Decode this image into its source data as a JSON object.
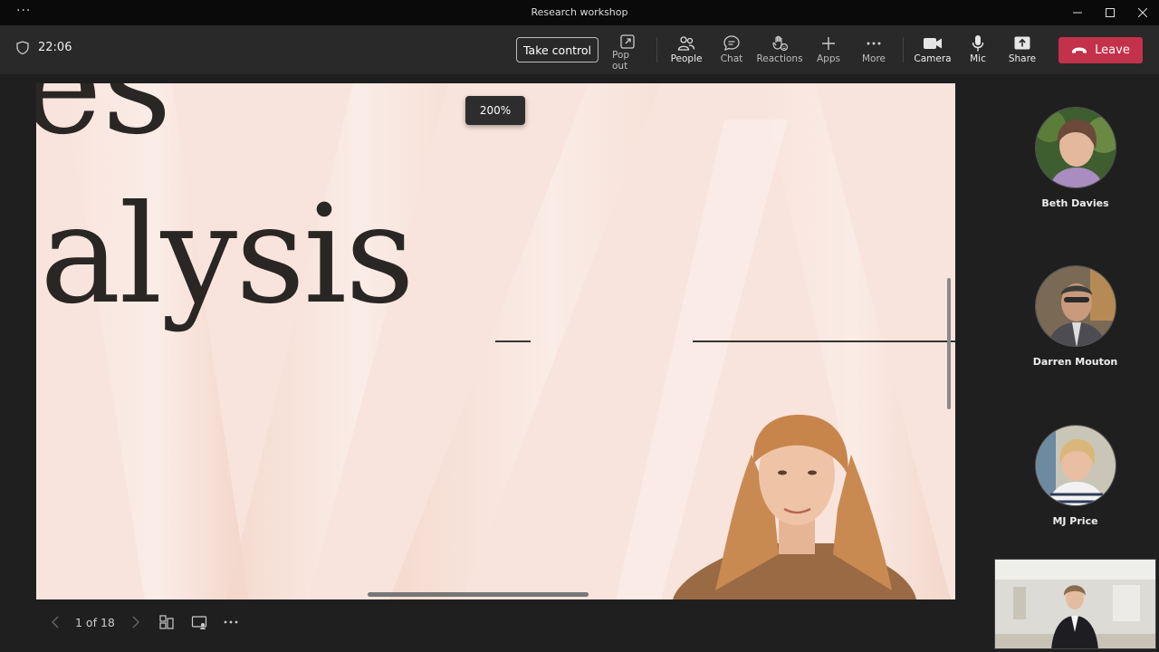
{
  "window": {
    "title": "Research workshop",
    "menu_icon": "more-horizontal-icon",
    "controls": [
      "minimize-icon",
      "maximize-icon",
      "close-icon"
    ]
  },
  "toolbar": {
    "timer": "22:06",
    "take_control_label": "Take control",
    "items": [
      {
        "label": "Pop out",
        "icon": "pop-out-icon"
      },
      {
        "label": "People",
        "icon": "people-icon"
      },
      {
        "label": "Chat",
        "icon": "chat-icon"
      },
      {
        "label": "Reactions",
        "icon": "reactions-icon"
      },
      {
        "label": "Apps",
        "icon": "plus-icon"
      },
      {
        "label": "More",
        "icon": "more-icon"
      },
      {
        "label": "Camera",
        "icon": "camera-icon"
      },
      {
        "label": "Mic",
        "icon": "mic-icon"
      },
      {
        "label": "Share",
        "icon": "share-icon"
      }
    ],
    "leave_label": "Leave"
  },
  "presentation": {
    "zoom_level": "200%",
    "slide_text_top": "es",
    "slide_text_main": "alysis",
    "page_indicator": "1 of 18"
  },
  "participants": [
    {
      "name": "Beth Davies"
    },
    {
      "name": "Darren Mouton"
    },
    {
      "name": "MJ Price"
    }
  ],
  "colors": {
    "leave": "#c4314b",
    "toolbar": "#292929",
    "titlebar": "#0a0a0a",
    "slide_bg": "#f8e4dc",
    "slide_text": "#2a2623"
  }
}
